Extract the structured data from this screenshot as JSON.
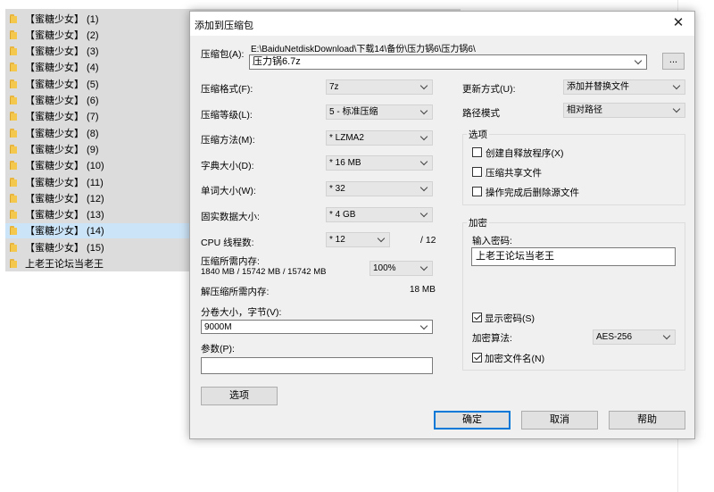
{
  "file_list": [
    {
      "label": "【蜜糖少女】 (1)",
      "selected": false
    },
    {
      "label": "【蜜糖少女】 (2)",
      "selected": false
    },
    {
      "label": "【蜜糖少女】 (3)",
      "selected": false
    },
    {
      "label": "【蜜糖少女】 (4)",
      "selected": false
    },
    {
      "label": "【蜜糖少女】 (5)",
      "selected": false
    },
    {
      "label": "【蜜糖少女】 (6)",
      "selected": false
    },
    {
      "label": "【蜜糖少女】 (7)",
      "selected": false
    },
    {
      "label": "【蜜糖少女】 (8)",
      "selected": false
    },
    {
      "label": "【蜜糖少女】 (9)",
      "selected": false
    },
    {
      "label": "【蜜糖少女】 (10)",
      "selected": false
    },
    {
      "label": "【蜜糖少女】 (11)",
      "selected": false
    },
    {
      "label": "【蜜糖少女】 (12)",
      "selected": false
    },
    {
      "label": "【蜜糖少女】 (13)",
      "selected": false
    },
    {
      "label": "【蜜糖少女】 (14)",
      "selected": true
    },
    {
      "label": "【蜜糖少女】 (15)",
      "selected": false
    },
    {
      "label": "上老王论坛当老王",
      "selected": false
    }
  ],
  "dialog": {
    "title": "添加到压缩包",
    "close_glyph": "✕",
    "archive_label": "压缩包(A):",
    "archive_path": "E:\\BaiduNetdiskDownload\\下载14\\备份\\压力锅6\\压力锅6\\",
    "archive_name": "压力锅6.7z",
    "browse_label": "...",
    "format_label": "压缩格式(F):",
    "format_value": "7z",
    "level_label": "压缩等级(L):",
    "level_value": "5 - 标准压缩",
    "method_label": "压缩方法(M):",
    "method_value": "* LZMA2",
    "dict_label": "字典大小(D):",
    "dict_value": "* 16 MB",
    "word_label": "单词大小(W):",
    "word_value": "* 32",
    "solid_label": "固实数据大小:",
    "solid_value": "* 4 GB",
    "cpu_label": "CPU 线程数:",
    "cpu_value": "* 12",
    "cpu_total": "/ 12",
    "mem_compress_label": "压缩所需内存:",
    "mem_compress_detail": "1840 MB / 15742 MB / 15742 MB",
    "mem_percent_value": "100%",
    "mem_decompress_label": "解压缩所需内存:",
    "mem_decompress_value": "18 MB",
    "volume_label": "分卷大小，字节(V):",
    "volume_value": "9000M",
    "params_label": "参数(P):",
    "params_value": "",
    "options_button": "选项",
    "update_label": "更新方式(U):",
    "update_value": "添加并替换文件",
    "path_mode_label": "路径模式",
    "path_mode_value": "相对路径",
    "options_group_title": "选项",
    "opt_sfx_label": "创建自释放程序(X)",
    "opt_shared_label": "压缩共享文件",
    "opt_delete_label": "操作完成后删除源文件",
    "encrypt_group_title": "加密",
    "password_label": "输入密码:",
    "password_value": "上老王论坛当老王",
    "show_password_label": "显示密码(S)",
    "enc_method_label": "加密算法:",
    "enc_method_value": "AES-256",
    "encrypt_names_label": "加密文件名(N)",
    "ok_button": "确定",
    "cancel_button": "取消",
    "help_button": "帮助"
  }
}
